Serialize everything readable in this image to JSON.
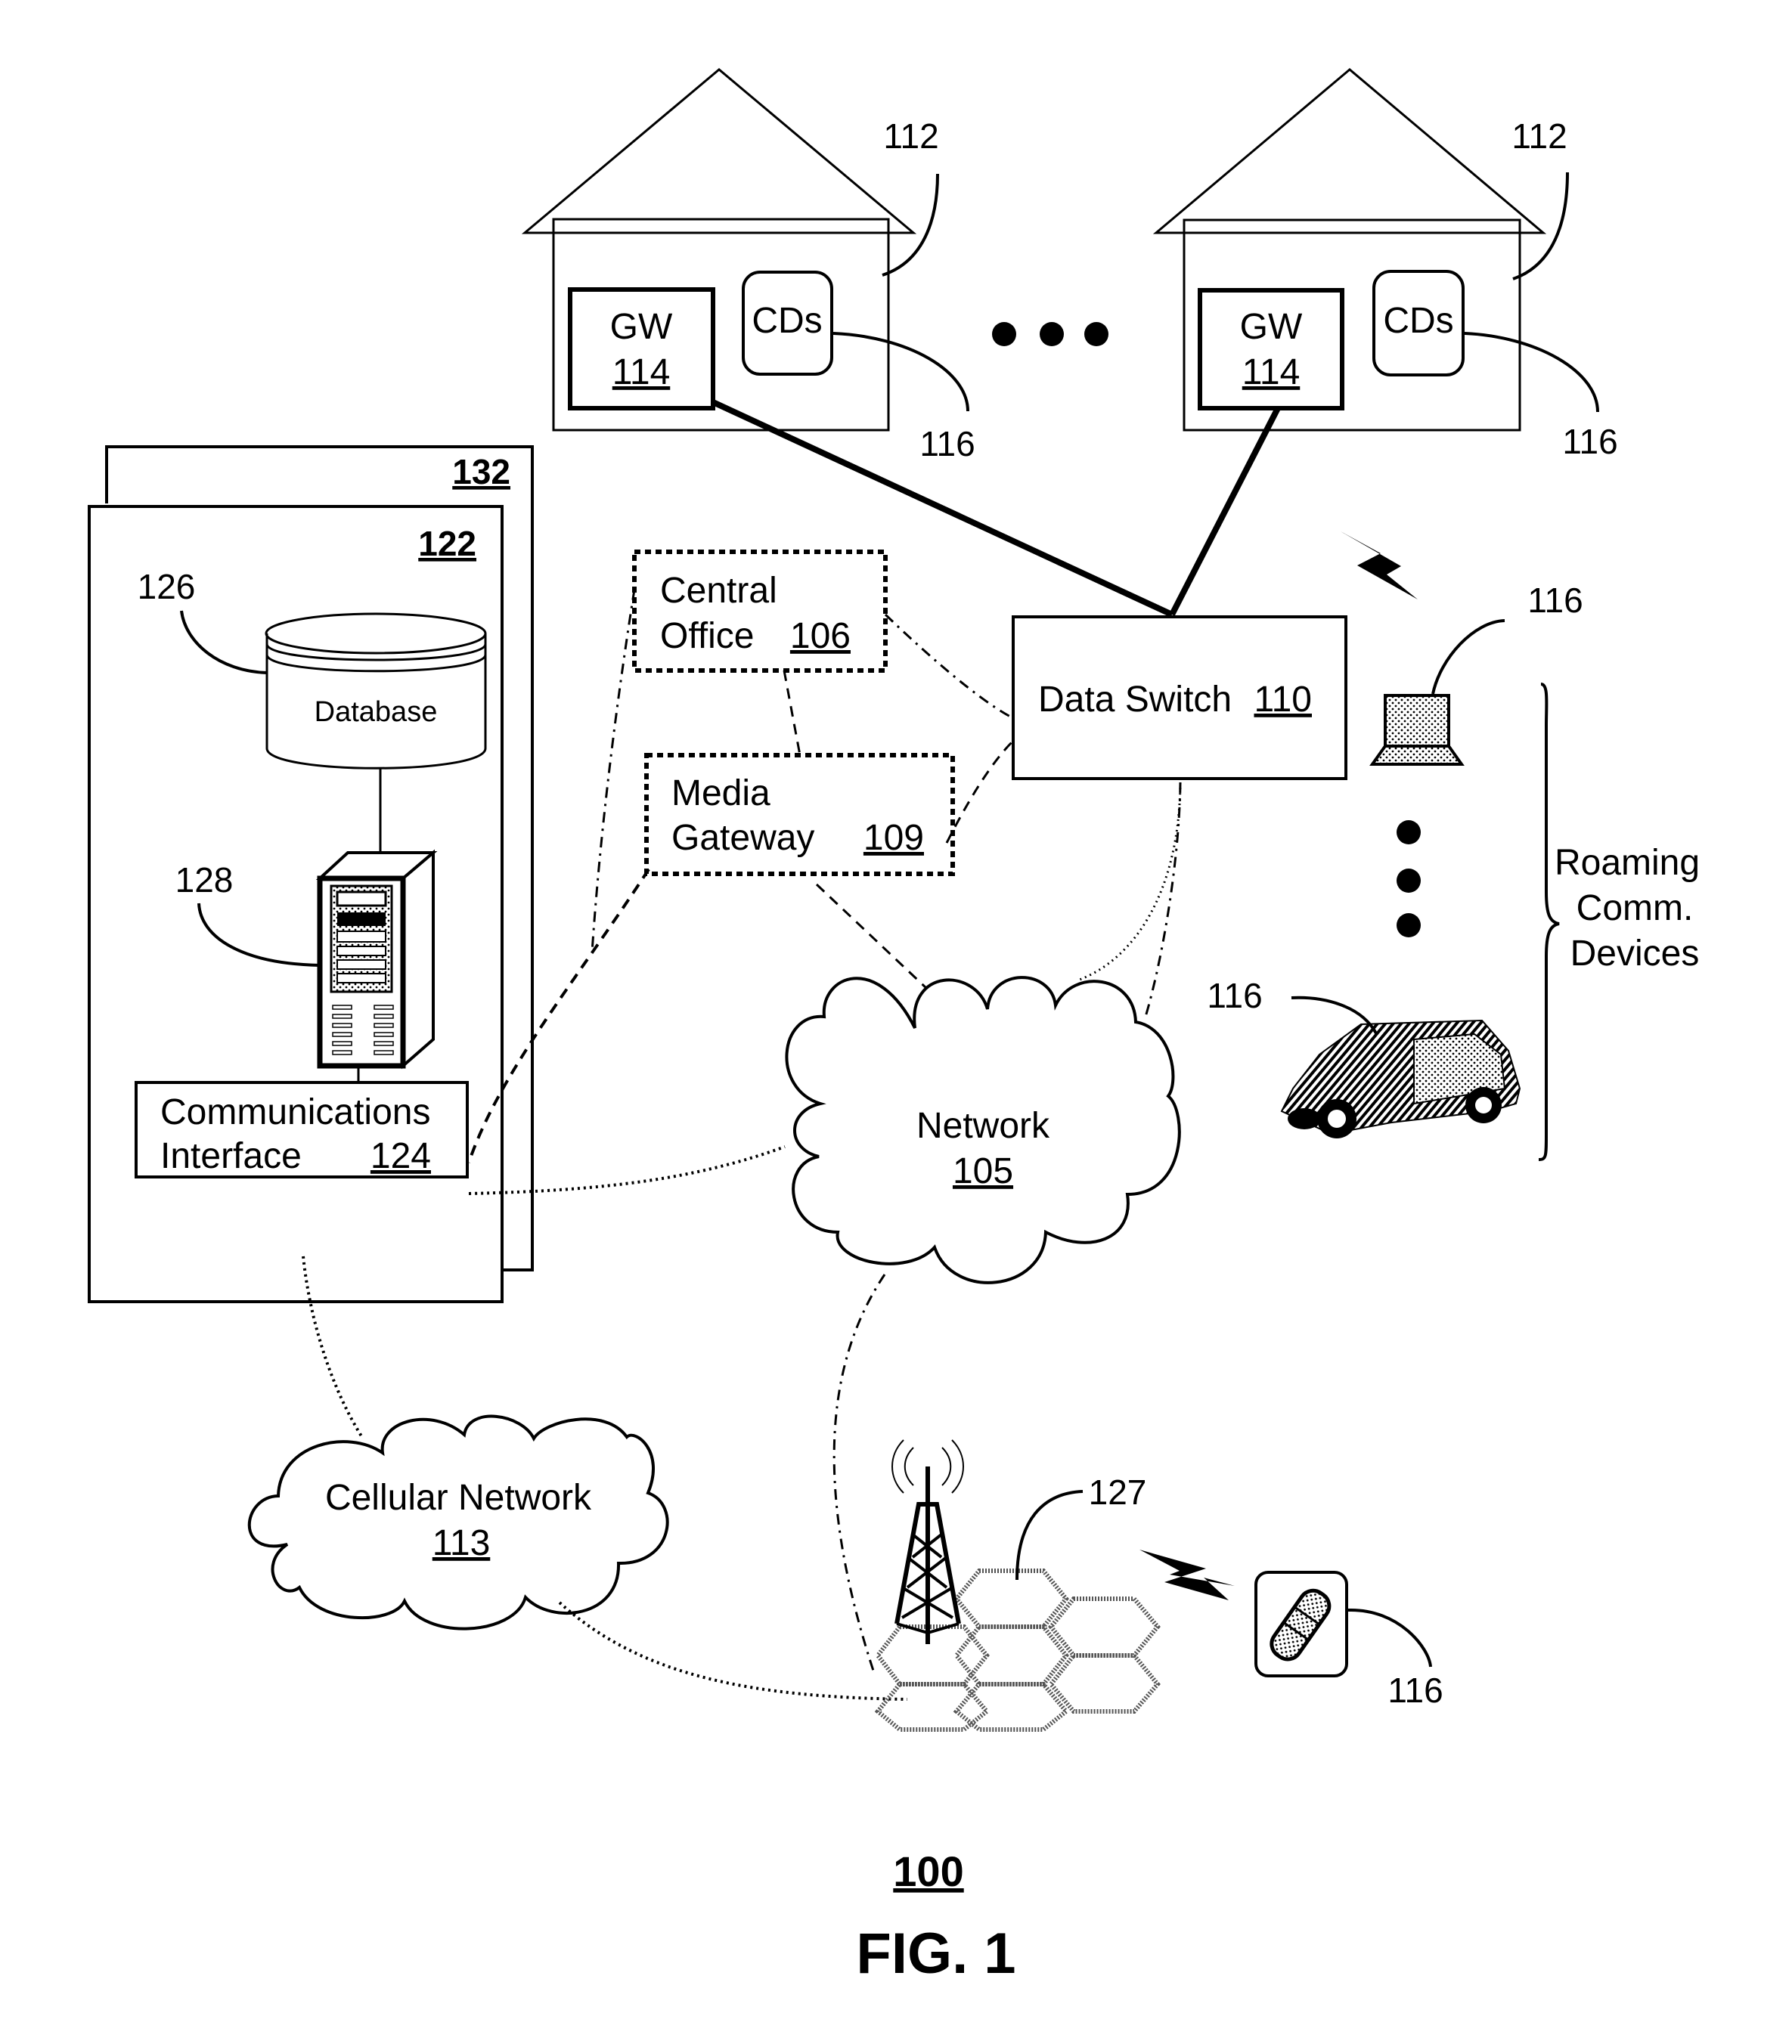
{
  "figure": {
    "number_label": "100",
    "caption": "FIG. 1"
  },
  "homes": [
    {
      "ref": "112",
      "gateway": {
        "label": "GW",
        "ref": "114"
      },
      "devices": {
        "label": "CDs",
        "ref": "116"
      }
    },
    {
      "ref": "112",
      "gateway": {
        "label": "GW",
        "ref": "114"
      },
      "devices": {
        "label": "CDs",
        "ref": "116"
      }
    }
  ],
  "central_office": {
    "line1": "Central",
    "line2": "Office",
    "ref": "106"
  },
  "media_gateway": {
    "line1": "Media",
    "line2": "Gateway",
    "ref": "109"
  },
  "data_switch": {
    "label": "Data Switch",
    "ref": "110"
  },
  "network": {
    "label": "Network",
    "ref": "105"
  },
  "cellular_network": {
    "label": "Cellular Network",
    "ref": "113"
  },
  "server_system": {
    "outer_ref": "132",
    "inner_ref": "122",
    "database": {
      "label": "Database",
      "ref": "126"
    },
    "server": {
      "ref": "128"
    },
    "comm_interface": {
      "line1": "Communications",
      "line2": "Interface",
      "ref": "124"
    }
  },
  "cell_site": {
    "ref": "127"
  },
  "roaming": {
    "label_line1": "Roaming",
    "label_line2": "Comm.",
    "label_line3": "Devices",
    "laptop_ref": "116",
    "vehicle_ref": "116",
    "phone_ref": "116"
  }
}
